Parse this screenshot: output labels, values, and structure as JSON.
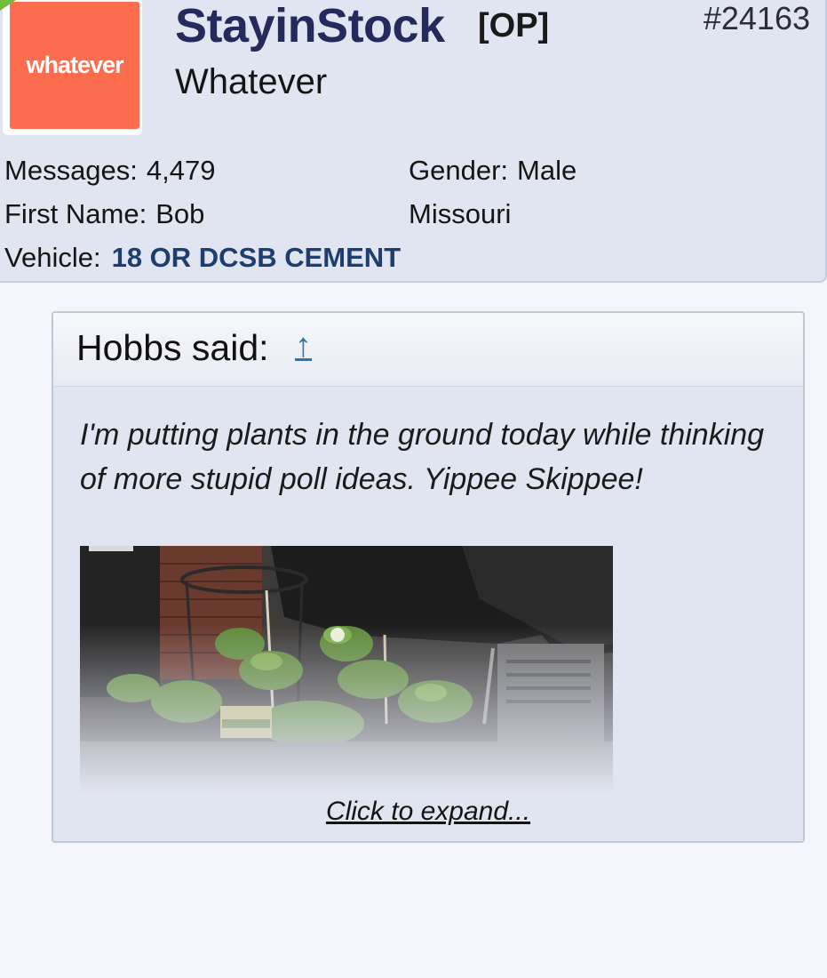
{
  "post": {
    "number": "#24163",
    "user": {
      "avatar_text": "whatever",
      "avatar_color": "#fb6d4e",
      "username": "StayinStock",
      "op_tag": "[OP]",
      "title": "Whatever"
    },
    "info": {
      "messages_label": "Messages:",
      "messages_value": "4,479",
      "first_name_label": "First Name:",
      "first_name_value": "Bob",
      "vehicle_label": "Vehicle:",
      "vehicle_value": "18 OR DCSB CEMENT",
      "gender_label": "Gender:",
      "gender_value": "Male",
      "location": "Missouri"
    }
  },
  "quote": {
    "author": "Hobbs said:",
    "jump_icon": "↑",
    "text": "I'm putting plants in the ground today while thinking of more stupid poll ideas. Yippee Skippee!",
    "image_alt": "pepper plants in pots on a patio next to a covered grill",
    "expand_label": "Click to expand..."
  },
  "colors": {
    "accent": "#252a5c",
    "link": "#2577b1",
    "vehicle": "#1d3e6e",
    "panel": "#e1e4f1",
    "page": "#f4f5fd"
  }
}
